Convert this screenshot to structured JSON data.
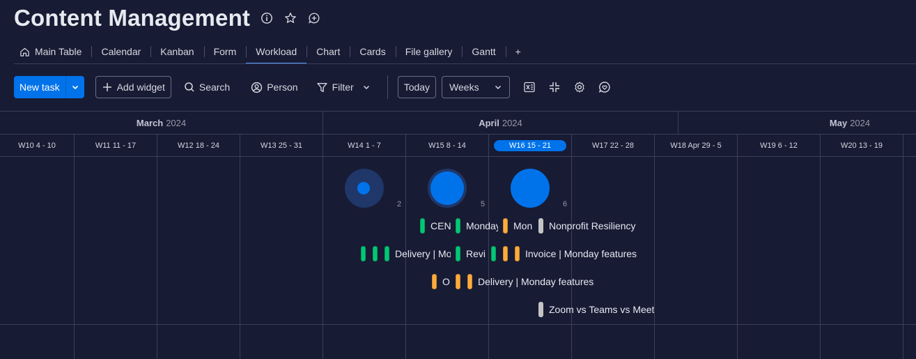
{
  "board": {
    "title": "Content Management"
  },
  "tabs": [
    {
      "label": "Main Table",
      "icon": "home-icon"
    },
    {
      "label": "Calendar"
    },
    {
      "label": "Kanban"
    },
    {
      "label": "Form"
    },
    {
      "label": "Workload",
      "active": true
    },
    {
      "label": "Chart"
    },
    {
      "label": "Cards"
    },
    {
      "label": "File gallery"
    },
    {
      "label": "Gantt"
    },
    {
      "label": "+"
    }
  ],
  "toolbar": {
    "new_task": "New task",
    "add_widget": "Add widget",
    "search": "Search",
    "person": "Person",
    "filter": "Filter",
    "today": "Today",
    "period": "Weeks"
  },
  "months": [
    {
      "name": "March",
      "year": "2024"
    },
    {
      "name": "April",
      "year": "2024"
    },
    {
      "name": "May",
      "year": "2024"
    }
  ],
  "weeks": [
    "W10 4 - 10",
    "W11 11 - 17",
    "W12 18 - 24",
    "W13 25 - 31",
    "W14 1 - 7",
    "W15 8 - 14",
    "W16 15 - 21",
    "W17 22 - 28",
    "W18 Apr 29 - 5",
    "W19 6 - 12",
    "W20 13 - 19"
  ],
  "current_week": "W16 15 - 21",
  "capacity": [
    {
      "week": "W14 1 - 7",
      "count": "2"
    },
    {
      "week": "W15 8 - 14",
      "count": "5"
    },
    {
      "week": "W16 15 - 21",
      "count": "6"
    }
  ],
  "task_labels": [
    "CEN",
    "Monday",
    "Mon",
    "Nonprofit Resiliency",
    "Delivery | Mo",
    "Revi",
    "Invoice | Monday features",
    "O",
    "Delivery | Monday features",
    "Zoom vs Teams vs Meet"
  ],
  "status_colors": {
    "done": "#00c875",
    "working": "#fdab3d",
    "none": "#c4c4c4",
    "accent": "#0073ea"
  }
}
